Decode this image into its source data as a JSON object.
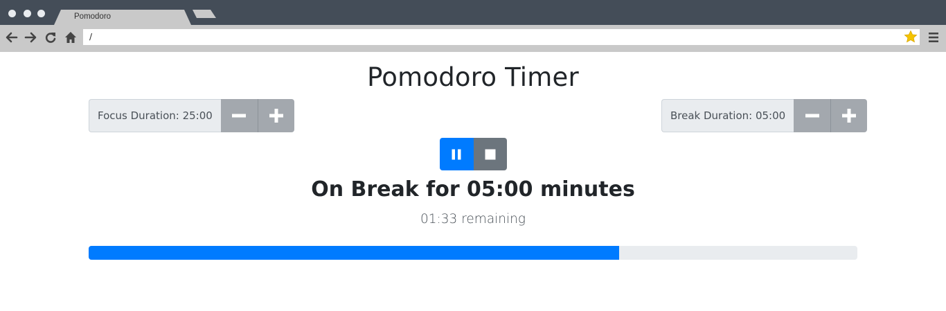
{
  "browser": {
    "tab_title": "Pomodoro",
    "url": "/"
  },
  "page": {
    "title": "Pomodoro Timer",
    "focus": {
      "label": "Focus Duration: 25:00"
    },
    "break": {
      "label": "Break Duration: 05:00"
    },
    "status_text": "On Break for 05:00 minutes",
    "remaining_text": "01:33 remaining",
    "progress_percent": 69,
    "accent_color": "#007bff",
    "secondary_color": "#6c757d",
    "icons": {
      "back": "arrow-left-icon",
      "forward": "arrow-right-icon",
      "reload": "reload-icon",
      "home": "home-icon",
      "bookmark": "star-icon",
      "menu": "hamburger-menu-icon",
      "decrement": "minus-icon",
      "increment": "plus-icon",
      "pause": "pause-icon",
      "stop": "stop-icon"
    }
  }
}
